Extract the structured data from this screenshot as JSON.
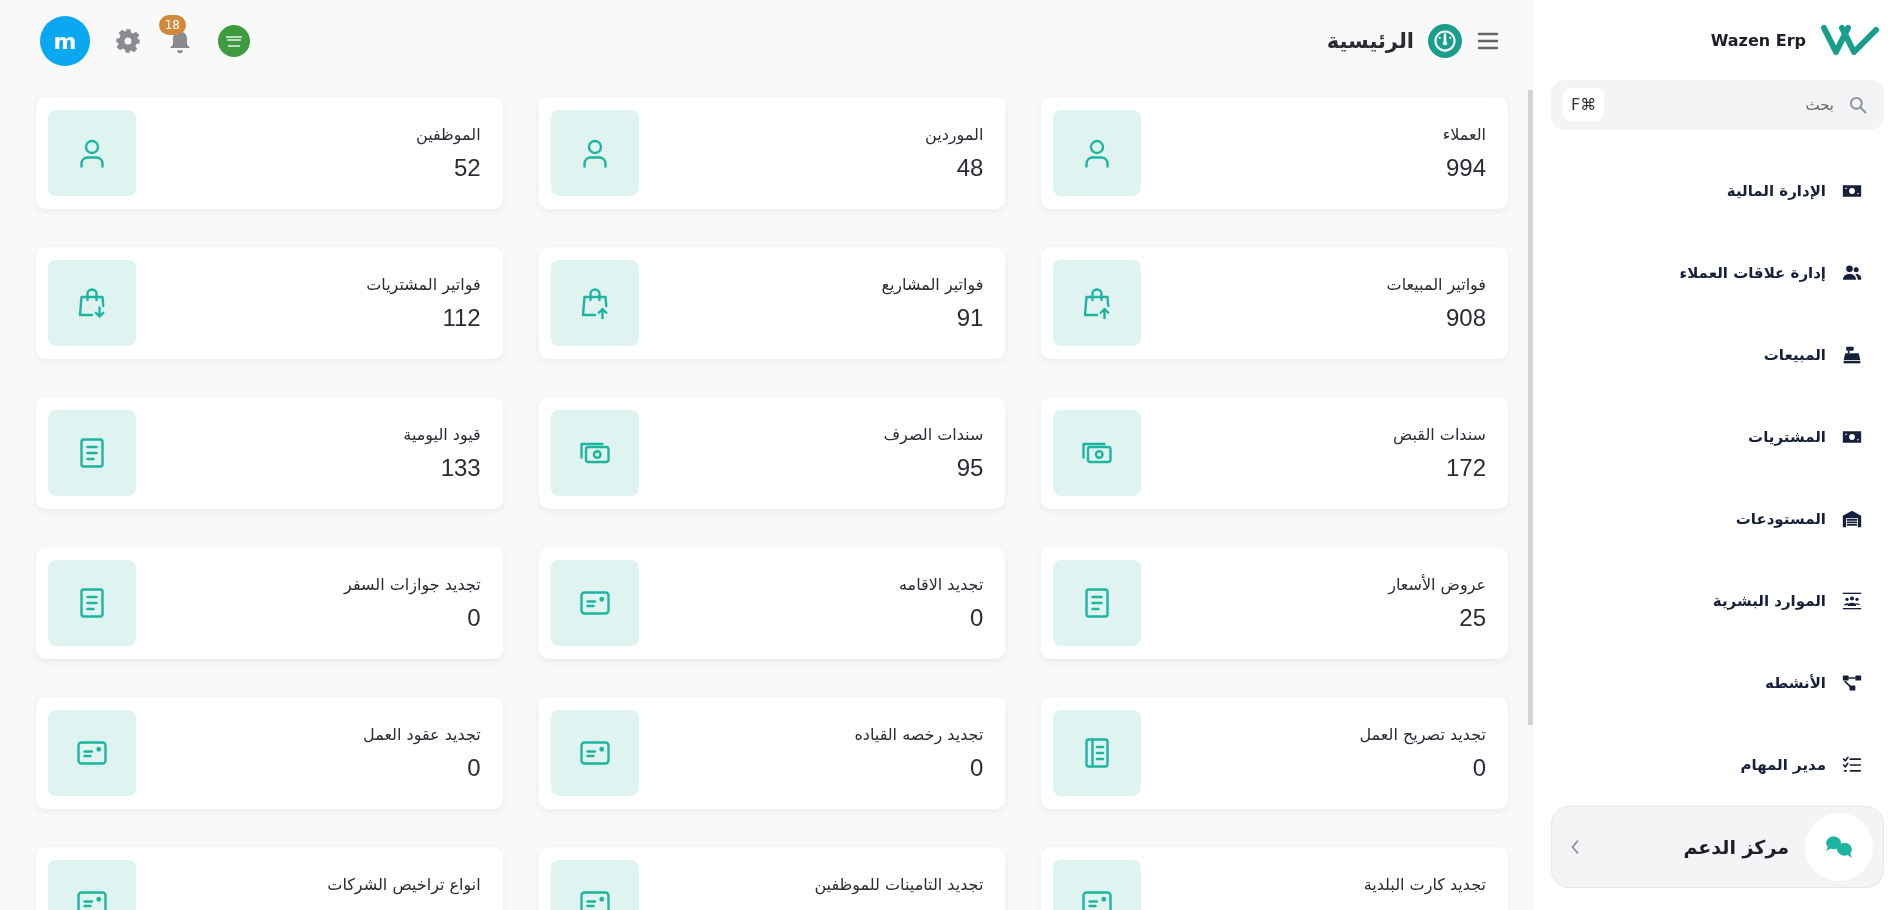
{
  "sidebar": {
    "brand": "Wazen Erp",
    "search": {
      "placeholder": "بحث",
      "shortcut": "F⌘"
    },
    "items": [
      {
        "label": "الإدارة المالية"
      },
      {
        "label": "إدارة علاقات العملاء"
      },
      {
        "label": "المبيعات"
      },
      {
        "label": "المشتريات"
      },
      {
        "label": "المستودعات"
      },
      {
        "label": "الموارد البشرية"
      },
      {
        "label": "الأنشطه"
      },
      {
        "label": "مدير المهام"
      }
    ],
    "support": {
      "label": "مركز الدعم"
    }
  },
  "header": {
    "title": "الرئيسية",
    "avatar": "m",
    "notifications": "18"
  },
  "cards": [
    {
      "title": "العملاء",
      "value": "994"
    },
    {
      "title": "الموردين",
      "value": "48"
    },
    {
      "title": "الموظفين",
      "value": "52"
    },
    {
      "title": "فواتير المبيعات",
      "value": "908"
    },
    {
      "title": "فواتير المشاريع",
      "value": "91"
    },
    {
      "title": "فواتير المشتريات",
      "value": "112"
    },
    {
      "title": "سندات القبض",
      "value": "172"
    },
    {
      "title": "سندات الصرف",
      "value": "95"
    },
    {
      "title": "قيود اليومية",
      "value": "133"
    },
    {
      "title": "عروض الأسعار",
      "value": "25"
    },
    {
      "title": "تجديد الاقامه",
      "value": "0"
    },
    {
      "title": "تجديد جوازات السفر",
      "value": "0"
    },
    {
      "title": "تجديد تصريح العمل",
      "value": "0"
    },
    {
      "title": "تجديد رخصه القياده",
      "value": "0"
    },
    {
      "title": "تجديد عقود العمل",
      "value": "0"
    },
    {
      "title": "تجديد كارت البلدية"
    },
    {
      "title": "تجديد التامينات للموظفين"
    },
    {
      "title": "انواع تراخيص الشركات"
    }
  ]
}
